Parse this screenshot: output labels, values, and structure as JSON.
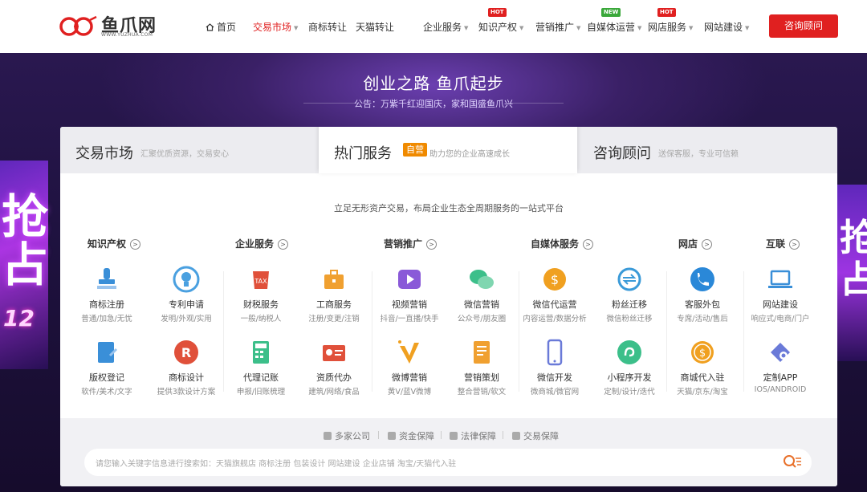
{
  "brand": {
    "name": "鱼爪网",
    "url": "WWW.YUZHUA.COM"
  },
  "nav": {
    "items": [
      {
        "label": "首页"
      },
      {
        "label": "交易市场",
        "dropdown": true,
        "active": true
      },
      {
        "label": "商标转让"
      },
      {
        "label": "天猫转让"
      },
      {
        "label": "企业服务",
        "dropdown": true
      },
      {
        "label": "知识产权",
        "dropdown": true,
        "badge": "HOT"
      },
      {
        "label": "营销推广",
        "dropdown": true
      },
      {
        "label": "自媒体运营",
        "dropdown": true,
        "badge": "NEW"
      },
      {
        "label": "网店服务",
        "dropdown": true,
        "badge": "HOT"
      },
      {
        "label": "网站建设",
        "dropdown": true
      }
    ],
    "cta": "咨询顾问"
  },
  "hero": {
    "title": "创业之路 鱼爪起步",
    "notice": "公告：万紫千红迎国庆，家和国盛鱼爪兴",
    "side_left_text": "抢\n占",
    "side_left_num": "12",
    "side_right_text": "抢\n占"
  },
  "tabs": [
    {
      "title": "交易市场",
      "subtitle": "汇聚优质资源，交易安心"
    },
    {
      "title": "热门服务",
      "badge": "自营",
      "subtitle": "助力您的企业高速成长",
      "active": true
    },
    {
      "title": "咨询顾问",
      "subtitle": "送保客服，专业可信赖"
    }
  ],
  "tagline": "立足无形资产交易，布局企业生态全周期服务的一站式平台",
  "categories": [
    {
      "label": "知识产权"
    },
    {
      "label": "企业服务"
    },
    {
      "label": "营销推广"
    },
    {
      "label": "自媒体服务"
    },
    {
      "label": "网店"
    },
    {
      "label": "互联"
    }
  ],
  "services": [
    {
      "name": "商标注册",
      "desc": "普通/加急/无忧",
      "icon": "stamp-icon",
      "color": "#3a8fd8"
    },
    {
      "name": "专利申请",
      "desc": "发明/外观/实用",
      "icon": "bulb-icon",
      "color": "#4aa0e0"
    },
    {
      "name": "财税服务",
      "desc": "一般/纳税人",
      "icon": "tax-icon",
      "color": "#e0503a"
    },
    {
      "name": "工商服务",
      "desc": "注册/变更/注销",
      "icon": "briefcase-icon",
      "color": "#f0a030"
    },
    {
      "name": "视频营销",
      "desc": "抖音/一直播/快手",
      "icon": "video-icon",
      "color": "#8a5ad8"
    },
    {
      "name": "微信营销",
      "desc": "公众号/朋友圈",
      "icon": "wechat-icon",
      "color": "#3cbf8a"
    },
    {
      "name": "微信代运营",
      "desc": "内容运营/数据分析",
      "icon": "coin-icon",
      "color": "#f0a020"
    },
    {
      "name": "粉丝迁移",
      "desc": "微信粉丝迁移",
      "icon": "transfer-icon",
      "color": "#3a9ad8"
    },
    {
      "name": "客服外包",
      "desc": "专席/活动/售后",
      "icon": "phone-icon",
      "color": "#2a88d8"
    },
    {
      "name": "网站建设",
      "desc": "响应式/电商/门户",
      "icon": "laptop-icon",
      "color": "#3a8fd8"
    },
    {
      "name": "版权登记",
      "desc": "软件/美术/文字",
      "icon": "copyright-icon",
      "color": "#3a8fd8"
    },
    {
      "name": "商标设计",
      "desc": "提供3款设计方案",
      "icon": "registered-icon",
      "color": "#e0503a"
    },
    {
      "name": "代理记账",
      "desc": "申报/旧账梳理",
      "icon": "calculator-icon",
      "color": "#3cbf8a"
    },
    {
      "name": "资质代办",
      "desc": "建筑/网络/食品",
      "icon": "id-card-icon",
      "color": "#e0503a"
    },
    {
      "name": "微博营销",
      "desc": "黄V/蓝V微博",
      "icon": "verified-v-icon",
      "color": "#f0a020"
    },
    {
      "name": "营销策划",
      "desc": "整合营销/软文",
      "icon": "document-icon",
      "color": "#f0a030"
    },
    {
      "name": "微信开发",
      "desc": "微商城/微官网",
      "icon": "mobile-icon",
      "color": "#6a7ad8"
    },
    {
      "name": "小程序开发",
      "desc": "定制/设计/迭代",
      "icon": "mini-program-icon",
      "color": "#3cbf8a"
    },
    {
      "name": "商城代入驻",
      "desc": "天猫/京东/淘宝",
      "icon": "dollar-coin-icon",
      "color": "#f0a020"
    },
    {
      "name": "定制APP",
      "desc": "IOS/ANDROID",
      "icon": "gear-tag-icon",
      "color": "#6a7ad8"
    }
  ],
  "guarantees": [
    "多家公司",
    "资金保障",
    "法律保障",
    "交易保障"
  ],
  "search": {
    "placeholder": "请您输入关键字信息进行搜索如：天猫旗舰店  商标注册  包装设计  网站建设  企业店铺  淘宝/天猫代入驻"
  }
}
